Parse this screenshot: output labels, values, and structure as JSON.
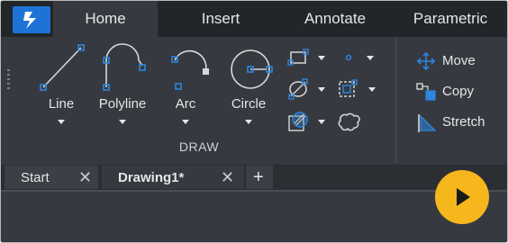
{
  "ribbon": {
    "tabs": [
      {
        "label": "Home"
      },
      {
        "label": "Insert"
      },
      {
        "label": "Annotate"
      },
      {
        "label": "Parametric"
      }
    ]
  },
  "draw_panel": {
    "title": "DRAW",
    "tools": [
      {
        "label": "Line",
        "icon": "line-icon"
      },
      {
        "label": "Polyline",
        "icon": "polyline-icon"
      },
      {
        "label": "Arc",
        "icon": "arc-icon"
      },
      {
        "label": "Circle",
        "icon": "circle-icon"
      }
    ]
  },
  "modify_panel": {
    "items": [
      {
        "label": "Move",
        "icon": "move-icon"
      },
      {
        "label": "Copy",
        "icon": "copy-icon"
      },
      {
        "label": "Stretch",
        "icon": "stretch-icon"
      }
    ]
  },
  "documents": {
    "tabs": [
      {
        "label": "Start"
      },
      {
        "label": "Drawing1*"
      }
    ],
    "new_tab_symbol": "+"
  },
  "colors": {
    "accent": "#1f73d6",
    "ribbon_bg": "#36393f",
    "tabbar_bg": "#22252a",
    "play_button": "#f6b71d",
    "icon_blue": "#2e86de"
  }
}
